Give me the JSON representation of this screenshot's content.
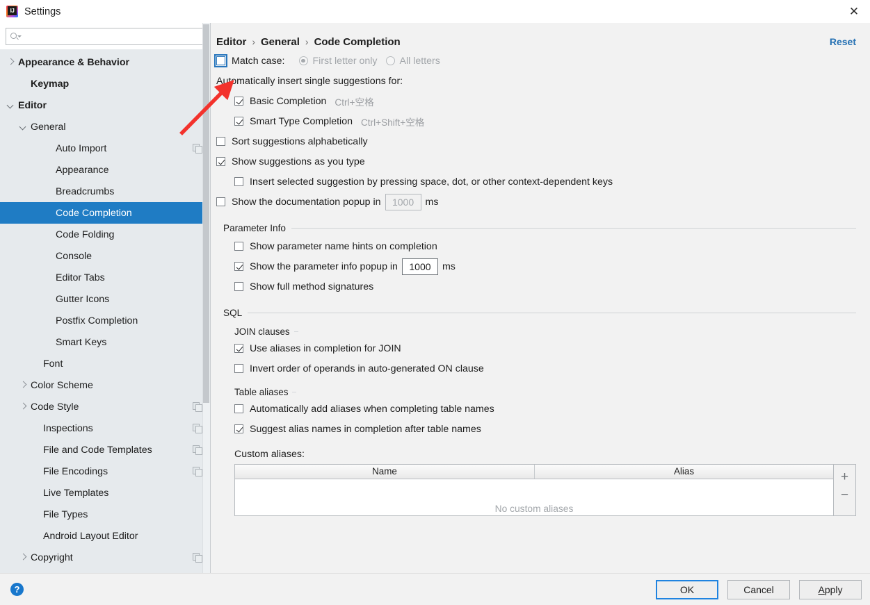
{
  "window": {
    "title": "Settings",
    "logo_icon": "intellij-idea-logo",
    "close_icon": "close-icon"
  },
  "sidebar": {
    "search": {
      "value": "",
      "placeholder": "",
      "icon": "search-icon"
    },
    "items": [
      {
        "label": "Appearance & Behavior",
        "indent": 0,
        "twisty": "right",
        "bold": true,
        "copy": false,
        "selected": false
      },
      {
        "label": "Keymap",
        "indent": 1,
        "twisty": "none",
        "bold": true,
        "copy": false,
        "selected": false
      },
      {
        "label": "Editor",
        "indent": 0,
        "twisty": "down",
        "bold": true,
        "copy": false,
        "selected": false
      },
      {
        "label": "General",
        "indent": 1,
        "twisty": "down",
        "bold": false,
        "copy": false,
        "selected": false
      },
      {
        "label": "Auto Import",
        "indent": 3,
        "twisty": "none",
        "bold": false,
        "copy": true,
        "selected": false
      },
      {
        "label": "Appearance",
        "indent": 3,
        "twisty": "none",
        "bold": false,
        "copy": false,
        "selected": false
      },
      {
        "label": "Breadcrumbs",
        "indent": 3,
        "twisty": "none",
        "bold": false,
        "copy": false,
        "selected": false
      },
      {
        "label": "Code Completion",
        "indent": 3,
        "twisty": "none",
        "bold": false,
        "copy": false,
        "selected": true
      },
      {
        "label": "Code Folding",
        "indent": 3,
        "twisty": "none",
        "bold": false,
        "copy": false,
        "selected": false
      },
      {
        "label": "Console",
        "indent": 3,
        "twisty": "none",
        "bold": false,
        "copy": false,
        "selected": false
      },
      {
        "label": "Editor Tabs",
        "indent": 3,
        "twisty": "none",
        "bold": false,
        "copy": false,
        "selected": false
      },
      {
        "label": "Gutter Icons",
        "indent": 3,
        "twisty": "none",
        "bold": false,
        "copy": false,
        "selected": false
      },
      {
        "label": "Postfix Completion",
        "indent": 3,
        "twisty": "none",
        "bold": false,
        "copy": false,
        "selected": false
      },
      {
        "label": "Smart Keys",
        "indent": 3,
        "twisty": "none",
        "bold": false,
        "copy": false,
        "selected": false
      },
      {
        "label": "Font",
        "indent": 2,
        "twisty": "none",
        "bold": false,
        "copy": false,
        "selected": false
      },
      {
        "label": "Color Scheme",
        "indent": 1,
        "twisty": "right",
        "bold": false,
        "copy": false,
        "selected": false
      },
      {
        "label": "Code Style",
        "indent": 1,
        "twisty": "right",
        "bold": false,
        "copy": true,
        "selected": false
      },
      {
        "label": "Inspections",
        "indent": 2,
        "twisty": "none",
        "bold": false,
        "copy": true,
        "selected": false
      },
      {
        "label": "File and Code Templates",
        "indent": 2,
        "twisty": "none",
        "bold": false,
        "copy": true,
        "selected": false
      },
      {
        "label": "File Encodings",
        "indent": 2,
        "twisty": "none",
        "bold": false,
        "copy": true,
        "selected": false
      },
      {
        "label": "Live Templates",
        "indent": 2,
        "twisty": "none",
        "bold": false,
        "copy": false,
        "selected": false
      },
      {
        "label": "File Types",
        "indent": 2,
        "twisty": "none",
        "bold": false,
        "copy": false,
        "selected": false
      },
      {
        "label": "Android Layout Editor",
        "indent": 2,
        "twisty": "none",
        "bold": false,
        "copy": false,
        "selected": false
      },
      {
        "label": "Copyright",
        "indent": 1,
        "twisty": "right",
        "bold": false,
        "copy": true,
        "selected": false
      }
    ]
  },
  "content": {
    "breadcrumb": [
      "Editor",
      "General",
      "Code Completion"
    ],
    "breadcrumb_separator": "›",
    "reset_label": "Reset",
    "match_case": {
      "label": "Match case:",
      "checked": false,
      "focused": true,
      "options": [
        {
          "label": "First letter only",
          "selected": true
        },
        {
          "label": "All letters",
          "selected": false
        }
      ]
    },
    "auto_insert_label": "Automatically insert single suggestions for:",
    "auto_insert_items": [
      {
        "label": "Basic Completion",
        "shortcut": "Ctrl+空格",
        "checked": true
      },
      {
        "label": "Smart Type Completion",
        "shortcut": "Ctrl+Shift+空格",
        "checked": true
      }
    ],
    "sort_suggestions": {
      "label": "Sort suggestions alphabetically",
      "checked": false
    },
    "show_suggestions": {
      "label": "Show suggestions as you type",
      "checked": true
    },
    "insert_selected": {
      "label": "Insert selected suggestion by pressing space, dot, or other context-dependent keys",
      "checked": false
    },
    "doc_popup": {
      "label": "Show the documentation popup in",
      "checked": false,
      "value": "1000",
      "unit": "ms"
    },
    "parameter_info": {
      "section_title": "Parameter Info",
      "hints": {
        "label": "Show parameter name hints on completion",
        "checked": false
      },
      "popup": {
        "label": "Show the parameter info popup in",
        "checked": true,
        "value": "1000",
        "unit": "ms"
      },
      "full_signatures": {
        "label": "Show full method signatures",
        "checked": false
      }
    },
    "sql": {
      "section_title": "SQL",
      "join_clauses_title": "JOIN clauses",
      "join_items": [
        {
          "label": "Use aliases in completion for JOIN",
          "checked": true
        },
        {
          "label": "Invert order of operands in auto-generated ON clause",
          "checked": false
        }
      ],
      "table_aliases_title": "Table aliases",
      "table_alias_items": [
        {
          "label": "Automatically add aliases when completing table names",
          "checked": false
        },
        {
          "label": "Suggest alias names in completion after table names",
          "checked": true
        }
      ],
      "custom_aliases_label": "Custom aliases:",
      "table": {
        "columns": [
          "Name",
          "Alias"
        ],
        "rows": [],
        "empty_text": "No custom aliases",
        "add_label": "+",
        "remove_label": "−"
      }
    }
  },
  "footer": {
    "help_label": "?",
    "buttons": [
      {
        "label": "OK",
        "default": true,
        "mnemonic": ""
      },
      {
        "label": "Cancel",
        "default": false,
        "mnemonic": ""
      },
      {
        "label": "Apply",
        "default": false,
        "mnemonic": "A"
      }
    ]
  },
  "annotation": {
    "arrow_color": "#f3322c",
    "points_to": "match-case-checkbox"
  }
}
